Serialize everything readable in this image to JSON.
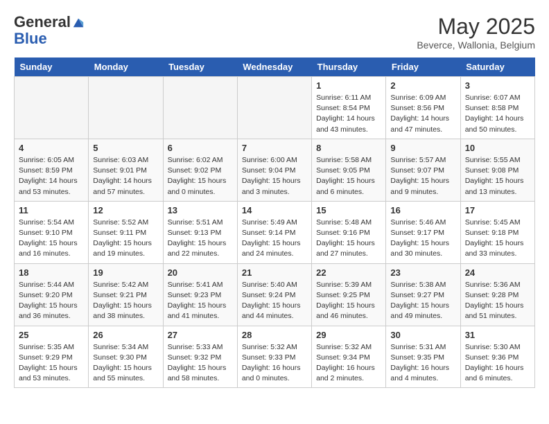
{
  "logo": {
    "line1": "General",
    "line2": "Blue"
  },
  "title": "May 2025",
  "location": "Beverce, Wallonia, Belgium",
  "weekdays": [
    "Sunday",
    "Monday",
    "Tuesday",
    "Wednesday",
    "Thursday",
    "Friday",
    "Saturday"
  ],
  "weeks": [
    [
      {
        "day": "",
        "info": ""
      },
      {
        "day": "",
        "info": ""
      },
      {
        "day": "",
        "info": ""
      },
      {
        "day": "",
        "info": ""
      },
      {
        "day": "1",
        "info": "Sunrise: 6:11 AM\nSunset: 8:54 PM\nDaylight: 14 hours\nand 43 minutes."
      },
      {
        "day": "2",
        "info": "Sunrise: 6:09 AM\nSunset: 8:56 PM\nDaylight: 14 hours\nand 47 minutes."
      },
      {
        "day": "3",
        "info": "Sunrise: 6:07 AM\nSunset: 8:58 PM\nDaylight: 14 hours\nand 50 minutes."
      }
    ],
    [
      {
        "day": "4",
        "info": "Sunrise: 6:05 AM\nSunset: 8:59 PM\nDaylight: 14 hours\nand 53 minutes."
      },
      {
        "day": "5",
        "info": "Sunrise: 6:03 AM\nSunset: 9:01 PM\nDaylight: 14 hours\nand 57 minutes."
      },
      {
        "day": "6",
        "info": "Sunrise: 6:02 AM\nSunset: 9:02 PM\nDaylight: 15 hours\nand 0 minutes."
      },
      {
        "day": "7",
        "info": "Sunrise: 6:00 AM\nSunset: 9:04 PM\nDaylight: 15 hours\nand 3 minutes."
      },
      {
        "day": "8",
        "info": "Sunrise: 5:58 AM\nSunset: 9:05 PM\nDaylight: 15 hours\nand 6 minutes."
      },
      {
        "day": "9",
        "info": "Sunrise: 5:57 AM\nSunset: 9:07 PM\nDaylight: 15 hours\nand 9 minutes."
      },
      {
        "day": "10",
        "info": "Sunrise: 5:55 AM\nSunset: 9:08 PM\nDaylight: 15 hours\nand 13 minutes."
      }
    ],
    [
      {
        "day": "11",
        "info": "Sunrise: 5:54 AM\nSunset: 9:10 PM\nDaylight: 15 hours\nand 16 minutes."
      },
      {
        "day": "12",
        "info": "Sunrise: 5:52 AM\nSunset: 9:11 PM\nDaylight: 15 hours\nand 19 minutes."
      },
      {
        "day": "13",
        "info": "Sunrise: 5:51 AM\nSunset: 9:13 PM\nDaylight: 15 hours\nand 22 minutes."
      },
      {
        "day": "14",
        "info": "Sunrise: 5:49 AM\nSunset: 9:14 PM\nDaylight: 15 hours\nand 24 minutes."
      },
      {
        "day": "15",
        "info": "Sunrise: 5:48 AM\nSunset: 9:16 PM\nDaylight: 15 hours\nand 27 minutes."
      },
      {
        "day": "16",
        "info": "Sunrise: 5:46 AM\nSunset: 9:17 PM\nDaylight: 15 hours\nand 30 minutes."
      },
      {
        "day": "17",
        "info": "Sunrise: 5:45 AM\nSunset: 9:18 PM\nDaylight: 15 hours\nand 33 minutes."
      }
    ],
    [
      {
        "day": "18",
        "info": "Sunrise: 5:44 AM\nSunset: 9:20 PM\nDaylight: 15 hours\nand 36 minutes."
      },
      {
        "day": "19",
        "info": "Sunrise: 5:42 AM\nSunset: 9:21 PM\nDaylight: 15 hours\nand 38 minutes."
      },
      {
        "day": "20",
        "info": "Sunrise: 5:41 AM\nSunset: 9:23 PM\nDaylight: 15 hours\nand 41 minutes."
      },
      {
        "day": "21",
        "info": "Sunrise: 5:40 AM\nSunset: 9:24 PM\nDaylight: 15 hours\nand 44 minutes."
      },
      {
        "day": "22",
        "info": "Sunrise: 5:39 AM\nSunset: 9:25 PM\nDaylight: 15 hours\nand 46 minutes."
      },
      {
        "day": "23",
        "info": "Sunrise: 5:38 AM\nSunset: 9:27 PM\nDaylight: 15 hours\nand 49 minutes."
      },
      {
        "day": "24",
        "info": "Sunrise: 5:36 AM\nSunset: 9:28 PM\nDaylight: 15 hours\nand 51 minutes."
      }
    ],
    [
      {
        "day": "25",
        "info": "Sunrise: 5:35 AM\nSunset: 9:29 PM\nDaylight: 15 hours\nand 53 minutes."
      },
      {
        "day": "26",
        "info": "Sunrise: 5:34 AM\nSunset: 9:30 PM\nDaylight: 15 hours\nand 55 minutes."
      },
      {
        "day": "27",
        "info": "Sunrise: 5:33 AM\nSunset: 9:32 PM\nDaylight: 15 hours\nand 58 minutes."
      },
      {
        "day": "28",
        "info": "Sunrise: 5:32 AM\nSunset: 9:33 PM\nDaylight: 16 hours\nand 0 minutes."
      },
      {
        "day": "29",
        "info": "Sunrise: 5:32 AM\nSunset: 9:34 PM\nDaylight: 16 hours\nand 2 minutes."
      },
      {
        "day": "30",
        "info": "Sunrise: 5:31 AM\nSunset: 9:35 PM\nDaylight: 16 hours\nand 4 minutes."
      },
      {
        "day": "31",
        "info": "Sunrise: 5:30 AM\nSunset: 9:36 PM\nDaylight: 16 hours\nand 6 minutes."
      }
    ]
  ]
}
